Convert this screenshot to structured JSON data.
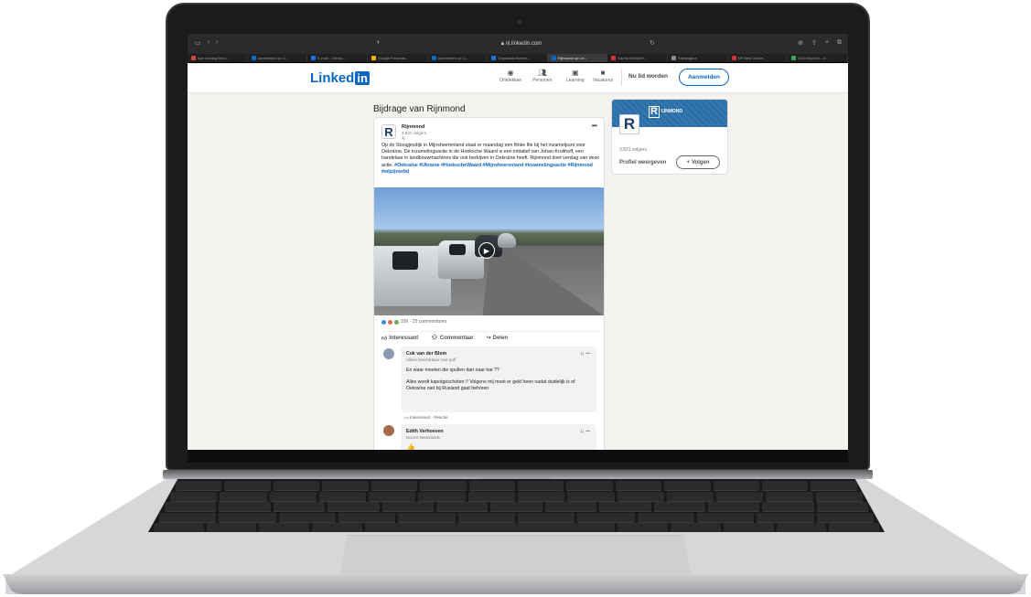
{
  "browser": {
    "url": "nl.linkedin.com",
    "tabs": [
      {
        "label": "Aan verslag Bera...",
        "color": "#d44638"
      },
      {
        "label": "Aanmelden op Li...",
        "color": "#0a66c2"
      },
      {
        "label": "E-mail – Gecso...",
        "color": "#1a73e8"
      },
      {
        "label": "Google Presenta...",
        "color": "#f4b400"
      },
      {
        "label": "Aanmelden op Li...",
        "color": "#0a66c2"
      },
      {
        "label": "Organisatorisches...",
        "color": "#1a73e8"
      },
      {
        "label": "Rijnmond op Lin...",
        "color": "#0a66c2"
      },
      {
        "label": "Karina Wendler/...",
        "color": "#d33"
      },
      {
        "label": "Startpagina",
        "color": "#888"
      },
      {
        "label": "NP Best Insulin...",
        "color": "#c33"
      },
      {
        "label": "DAD Beyond – A...",
        "color": "#34a853"
      }
    ],
    "active_tab": 6
  },
  "nav": {
    "logo_text": "Linked",
    "logo_in": "in",
    "items": [
      "Ontdekken",
      "Personen",
      "Learning",
      "Vacatures"
    ],
    "join": "Nu lid worden",
    "signin": "Aanmelden"
  },
  "page": {
    "heading": "Bijdrage van Rijnmond"
  },
  "post": {
    "author": "Rijnmond",
    "followers": "3.831 volgers",
    "time": "1j",
    "text": "Op de Stougjesdijk in Mijnsheerenland staat er maandag een flinke file bij het inzamelpunt voor Oekraïne. De inzamelingsactie in de Hoeksche Waard is een initiatief van Johan Kruithoff, een handelaar in landbouwmachines die ook bedrijven in Oekraïne heeft. Rijnmond doet verslag van deze actie.",
    "hashtags": "#Oekraïne #Ukraine #HoekscheWaard #Mijnsheerenland #inzamelingsactie #Rijnmond #wijzijnerbij",
    "reactions": "936 · 25 commentaren",
    "actions": {
      "like": "Interessant",
      "comment": "Commentaar",
      "share": "Delen"
    }
  },
  "comments": [
    {
      "name": "Cok van der Blom",
      "subtitle": "Alleen beschikbaar voor golf",
      "time": "1j",
      "text": [
        "En waar moeten die spullen dan naar toe ??",
        "Alles wordt kapotgeschoten !! Volgens mij moet er geld heen nadat duidelijk is of Oekraïne niet bij Rusland gaat behoren"
      ],
      "footer": "Interessant · Reactie"
    },
    {
      "name": "Edith Verhoeven",
      "subtitle": "Docent Nederlands",
      "time": "1j"
    }
  ],
  "sidebar": {
    "banner_text": "IJNMOND",
    "followers": "3.831 volgers",
    "profile": "Profiel weergeven",
    "follow": "Volgen"
  }
}
